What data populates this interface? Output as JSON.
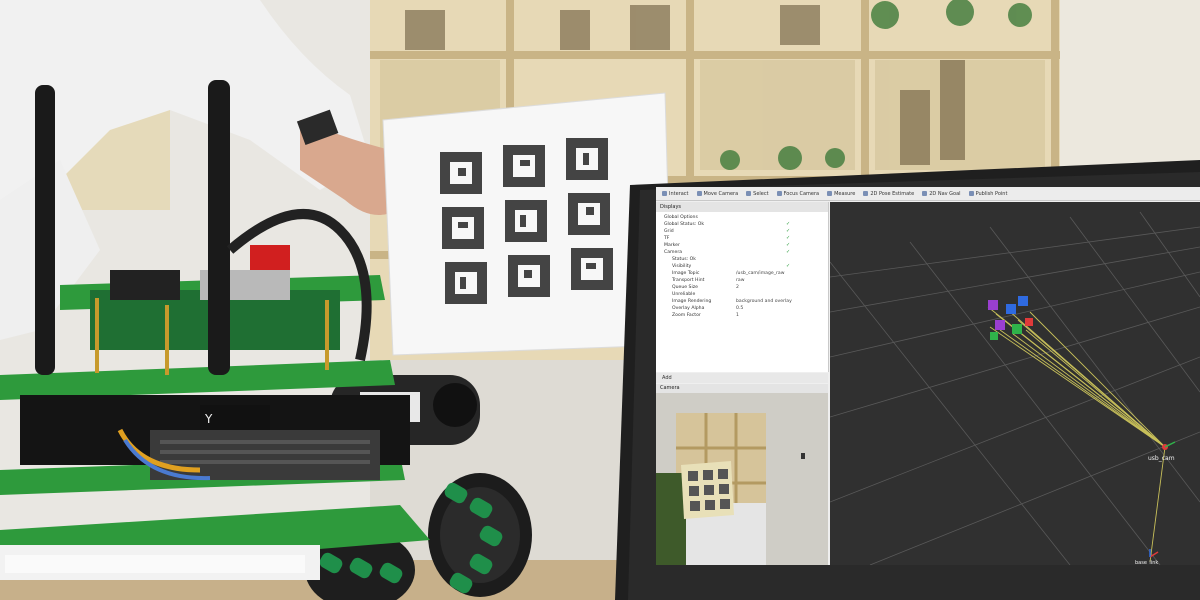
{
  "toolbar": {
    "items": [
      "Interact",
      "Move Camera",
      "Select",
      "Focus Camera",
      "Measure",
      "2D Pose Estimate",
      "2D Nav Goal",
      "Publish Point"
    ]
  },
  "displays": {
    "title": "Displays",
    "rows": [
      {
        "label": "Global Options",
        "value": "",
        "check": ""
      },
      {
        "label": "Global Status: Ok",
        "value": "",
        "check": "✓"
      },
      {
        "label": "Grid",
        "value": "",
        "check": "✓"
      },
      {
        "label": "TF",
        "value": "",
        "check": "✓"
      },
      {
        "label": "Marker",
        "value": "",
        "check": "✓"
      },
      {
        "label": "Camera",
        "value": "",
        "check": "✓"
      },
      {
        "label": "Status: Ok",
        "value": "",
        "check": ""
      },
      {
        "label": "Visibility",
        "value": "",
        "check": "✓"
      },
      {
        "label": "Image Topic",
        "value": "/usb_cam/image_raw",
        "check": ""
      },
      {
        "label": "Transport Hint",
        "value": "raw",
        "check": ""
      },
      {
        "label": "Queue Size",
        "value": "2",
        "check": ""
      },
      {
        "label": "Unreliable",
        "value": "",
        "check": ""
      },
      {
        "label": "Image Rendering",
        "value": "background and overlay",
        "check": ""
      },
      {
        "label": "Overlay Alpha",
        "value": "0.5",
        "check": ""
      },
      {
        "label": "Zoom Factor",
        "value": "1",
        "check": ""
      }
    ]
  },
  "add_bar": {
    "label": "Add"
  },
  "camera_panel": {
    "title": "Camera"
  },
  "viewport": {
    "cam_label": "usb_cam",
    "base_label": "base_link"
  },
  "colors": {
    "grid": "#5a5a5a",
    "ray": "#c8c05a",
    "robot_board": "#2e9a3c"
  }
}
